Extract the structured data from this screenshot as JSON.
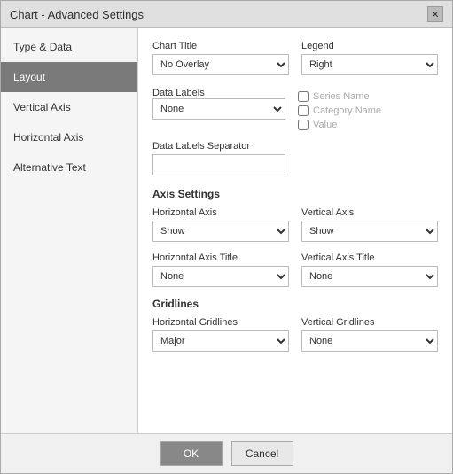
{
  "dialog": {
    "title": "Chart - Advanced Settings",
    "close_label": "✕"
  },
  "sidebar": {
    "items": [
      {
        "id": "type-data",
        "label": "Type & Data"
      },
      {
        "id": "layout",
        "label": "Layout",
        "active": true
      },
      {
        "id": "vertical-axis",
        "label": "Vertical Axis"
      },
      {
        "id": "horizontal-axis",
        "label": "Horizontal Axis"
      },
      {
        "id": "alternative-text",
        "label": "Alternative Text"
      }
    ]
  },
  "content": {
    "chart_title_label": "Chart Title",
    "chart_title_options": [
      "No Overlay"
    ],
    "chart_title_selected": "No Overlay",
    "legend_label": "Legend",
    "legend_options": [
      "Right"
    ],
    "legend_selected": "Right",
    "data_labels_label": "Data Labels",
    "data_labels_options": [
      "None"
    ],
    "data_labels_selected": "None",
    "checkboxes": [
      {
        "id": "series-name",
        "label": "Series Name",
        "checked": false
      },
      {
        "id": "category-name",
        "label": "Category Name",
        "checked": false
      },
      {
        "id": "value",
        "label": "Value",
        "checked": false
      }
    ],
    "data_labels_separator_label": "Data Labels Separator",
    "axis_settings_title": "Axis Settings",
    "horizontal_axis_label": "Horizontal Axis",
    "horizontal_axis_options": [
      "Show"
    ],
    "horizontal_axis_selected": "Show",
    "vertical_axis_label": "Vertical Axis",
    "vertical_axis_options": [
      "Show"
    ],
    "vertical_axis_selected": "Show",
    "horizontal_axis_title_label": "Horizontal Axis Title",
    "horizontal_axis_title_options": [
      "None"
    ],
    "horizontal_axis_title_selected": "None",
    "vertical_axis_title_label": "Vertical Axis Title",
    "vertical_axis_title_options": [
      "None"
    ],
    "vertical_axis_title_selected": "None",
    "gridlines_title": "Gridlines",
    "horizontal_gridlines_label": "Horizontal Gridlines",
    "horizontal_gridlines_options": [
      "Major"
    ],
    "horizontal_gridlines_selected": "Major",
    "vertical_gridlines_label": "Vertical Gridlines",
    "vertical_gridlines_options": [
      "None"
    ],
    "vertical_gridlines_selected": "None"
  },
  "footer": {
    "ok_label": "OK",
    "cancel_label": "Cancel"
  }
}
